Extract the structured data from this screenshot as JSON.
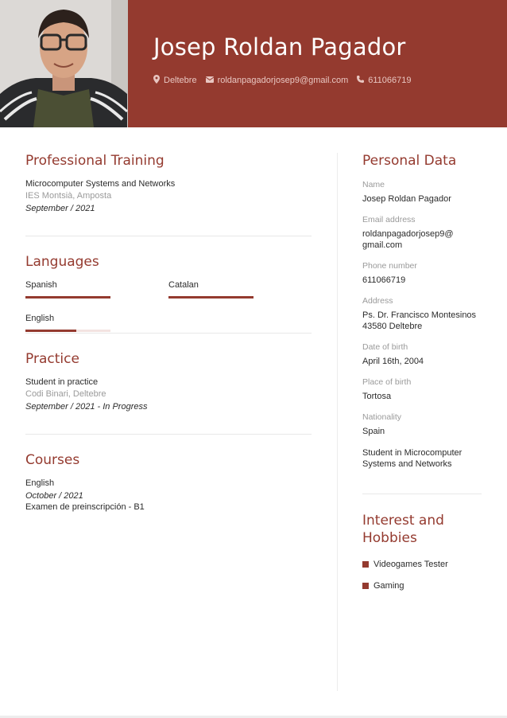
{
  "header": {
    "name": "Josep Roldan Pagador",
    "location": "Deltebre",
    "email": "roldanpagadorjosep9@gmail.com",
    "phone": "611066719",
    "accent_color": "#943a2f"
  },
  "training": {
    "title": "Professional Training",
    "degree": "Microcomputer Systems and Networks",
    "school": "IES Montsià, Amposta",
    "date": "September / 2021"
  },
  "languages": {
    "title": "Languages",
    "items": [
      {
        "name": "Spanish",
        "level": 1.0
      },
      {
        "name": "Catalan",
        "level": 1.0
      },
      {
        "name": "English",
        "level": 0.6
      }
    ]
  },
  "practice": {
    "title": "Practice",
    "role": "Student in practice",
    "company": "Codi Binari, Deltebre",
    "date": "September / 2021 - In Progress"
  },
  "courses": {
    "title": "Courses",
    "name": "English",
    "date": "October / 2021",
    "detail": "Examen de preinscripción - B1"
  },
  "personal": {
    "title": "Personal Data",
    "name_label": "Name",
    "name_value": "Josep Roldan Pagador",
    "email_label": "Email address",
    "email_value_1": "roldanpagadorjosep9@",
    "email_value_2": "gmail.com",
    "phone_label": "Phone number",
    "phone_value": "611066719",
    "address_label": "Address",
    "address_value_1": "Ps. Dr. Francisco Montesinos",
    "address_value_2": "43580 Deltebre",
    "dob_label": "Date of birth",
    "dob_value": "April 16th, 2004",
    "pob_label": "Place of birth",
    "pob_value": "Tortosa",
    "nationality_label": "Nationality",
    "nationality_value": "Spain",
    "status_1": "Student in Microcomputer",
    "status_2": "Systems and Networks"
  },
  "hobbies": {
    "title_1": "Interest and",
    "title_2": "Hobbies",
    "items": [
      "Videogames Tester",
      "Gaming"
    ]
  },
  "icons": {
    "location": "map-pin-icon",
    "email": "envelope-icon",
    "phone": "phone-icon"
  }
}
